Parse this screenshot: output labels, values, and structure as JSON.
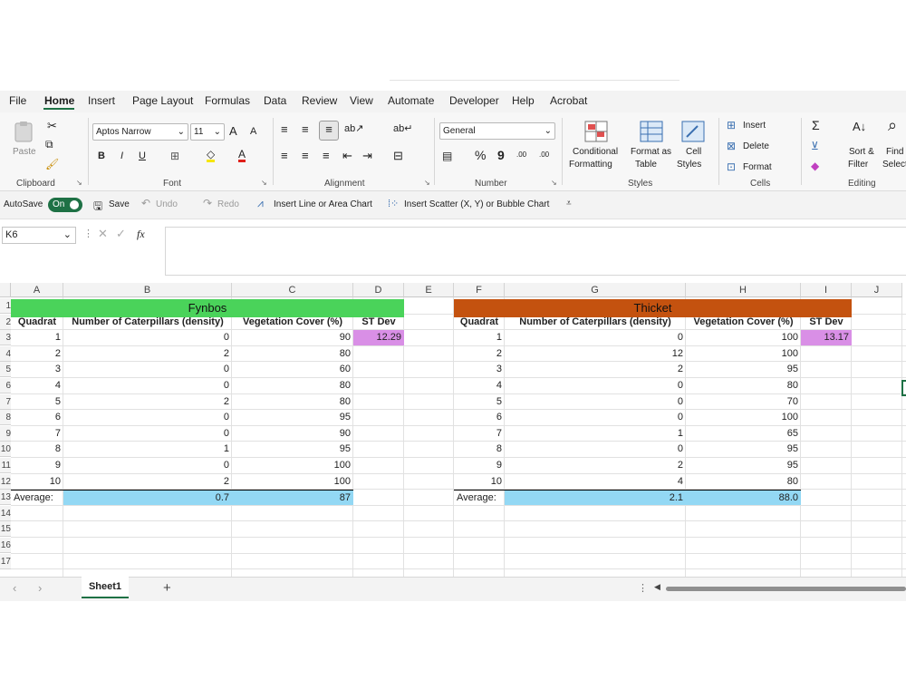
{
  "menu": {
    "tabs": [
      "File",
      "Home",
      "Insert",
      "Page Layout",
      "Formulas",
      "Data",
      "Review",
      "View",
      "Automate",
      "Developer",
      "Help",
      "Acrobat"
    ],
    "active": "Home"
  },
  "ribbon": {
    "clipboard": {
      "paste": "Paste",
      "label": "Clipboard"
    },
    "font": {
      "name": "Aptos Narrow",
      "size": "11",
      "grow": "A",
      "shrink": "A",
      "bold": "B",
      "italic": "I",
      "underline": "U",
      "label": "Font"
    },
    "alignment": {
      "label": "Alignment"
    },
    "number": {
      "format": "General",
      "percent": "%",
      "comma": "9",
      "inc_decimals": ".00",
      "dec_decimals": ".00",
      "label": "Number"
    },
    "styles": {
      "conditional": "Conditional",
      "conditional2": "Formatting",
      "format_table": "Format as",
      "format_table2": "Table",
      "cell_styles": "Cell",
      "cell_styles2": "Styles",
      "label": "Styles"
    },
    "cells": {
      "insert": "Insert",
      "delete": "Delete",
      "format": "Format",
      "label": "Cells"
    },
    "editing": {
      "sort": "Sort &",
      "sort2": "Filter",
      "find": "Find &",
      "find2": "Select",
      "label": "Editing"
    }
  },
  "qat": {
    "autosave": "AutoSave",
    "toggle": "On",
    "save": "Save",
    "undo": "Undo",
    "redo": "Redo",
    "line_chart": "Insert Line or Area Chart",
    "scatter_chart": "Insert Scatter (X, Y) or Bubble Chart"
  },
  "formula_bar": {
    "name_box": "K6",
    "fx": "fx",
    "value": ""
  },
  "columns": [
    "A",
    "B",
    "C",
    "D",
    "E",
    "F",
    "G",
    "H",
    "I",
    "J"
  ],
  "rows": [
    "1",
    "2",
    "3",
    "4",
    "5",
    "6",
    "7",
    "8",
    "9",
    "10",
    "11",
    "12",
    "13",
    "14",
    "15",
    "16",
    "17"
  ],
  "fynbos": {
    "title": "Fynbos",
    "headers": [
      "Quadrat",
      "Number of Caterpillars (density)",
      "Vegetation Cover (%)",
      "ST Dev"
    ],
    "rows": [
      [
        "1",
        "0",
        "90"
      ],
      [
        "2",
        "2",
        "80"
      ],
      [
        "3",
        "0",
        "60"
      ],
      [
        "4",
        "0",
        "80"
      ],
      [
        "5",
        "2",
        "80"
      ],
      [
        "6",
        "0",
        "95"
      ],
      [
        "7",
        "0",
        "90"
      ],
      [
        "8",
        "1",
        "95"
      ],
      [
        "9",
        "0",
        "100"
      ],
      [
        "10",
        "2",
        "100"
      ]
    ],
    "stdev": "12.29",
    "average_label": "Average:",
    "avg_caterpillars": "0.7",
    "avg_cover": "87"
  },
  "thicket": {
    "title": "Thicket",
    "headers": [
      "Quadrat",
      "Number of Caterpillars (density)",
      "Vegetation Cover (%)",
      "ST Dev"
    ],
    "rows": [
      [
        "1",
        "0",
        "100"
      ],
      [
        "2",
        "12",
        "100"
      ],
      [
        "3",
        "2",
        "95"
      ],
      [
        "4",
        "0",
        "80"
      ],
      [
        "5",
        "0",
        "70"
      ],
      [
        "6",
        "0",
        "100"
      ],
      [
        "7",
        "1",
        "65"
      ],
      [
        "8",
        "0",
        "95"
      ],
      [
        "9",
        "2",
        "95"
      ],
      [
        "10",
        "4",
        "80"
      ]
    ],
    "stdev": "13.17",
    "average_label": "Average:",
    "avg_caterpillars": "2.1",
    "avg_cover": "88.0"
  },
  "sheet_tabs": {
    "active": "Sheet1",
    "add": "+"
  },
  "colors": {
    "fynbos_green": "#4ad35a",
    "thicket_orange": "#c4520f",
    "stdev_pink": "#d98fe6",
    "average_blue": "#93d8f4",
    "excel_green": "#1e7145"
  }
}
